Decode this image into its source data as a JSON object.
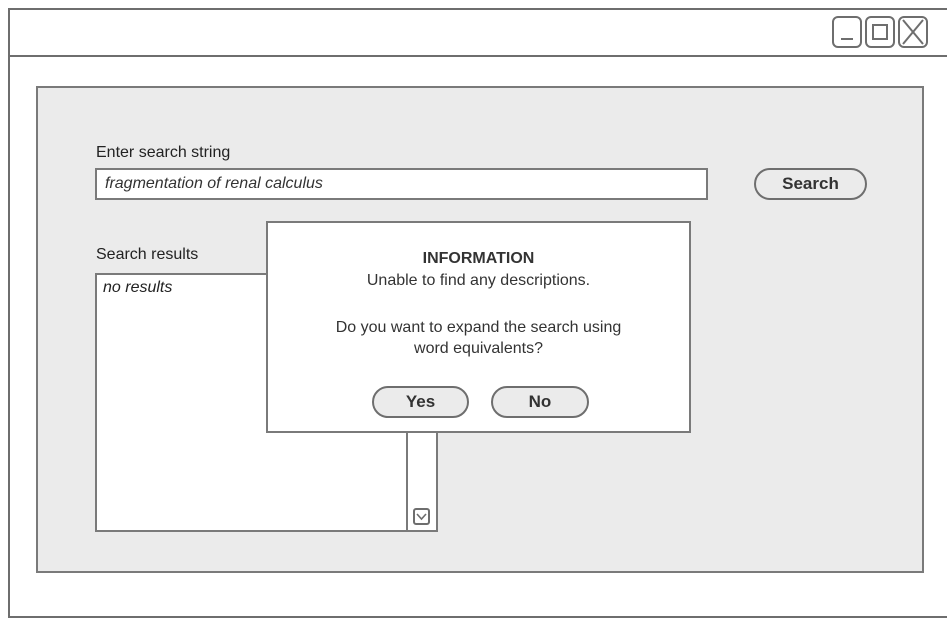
{
  "window": {
    "controls": [
      {
        "name": "minimize",
        "icon": "minimize-icon"
      },
      {
        "name": "maximize",
        "icon": "maximize-icon"
      },
      {
        "name": "close",
        "icon": "close-icon"
      }
    ]
  },
  "search": {
    "label": "Enter search string",
    "value": "fragmentation of renal calculus",
    "button_label": "Search"
  },
  "results": {
    "label": "Search results",
    "items": [
      "no results"
    ]
  },
  "dialog": {
    "title": "INFORMATION",
    "message": "Unable to find any descriptions.",
    "question_line1": "Do you want to expand the search using",
    "question_line2": "word equivalents?",
    "yes_label": "Yes",
    "no_label": "No"
  },
  "colors": {
    "border": "#6e6e6e",
    "panel_background": "#ebebeb",
    "surface": "#ffffff"
  }
}
